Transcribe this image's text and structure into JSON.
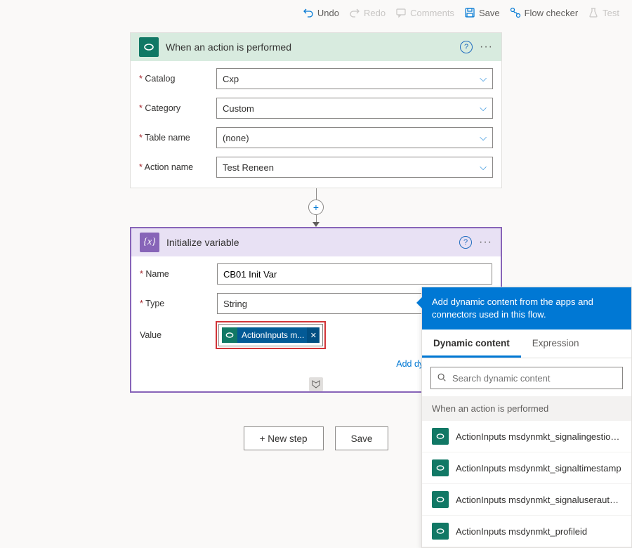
{
  "toolbar": {
    "undo": "Undo",
    "redo": "Redo",
    "comments": "Comments",
    "save": "Save",
    "flowchecker": "Flow checker",
    "test": "Test"
  },
  "trigger": {
    "title": "When an action is performed",
    "fields": {
      "catalog_label": "Catalog",
      "catalog_value": "Cxp",
      "category_label": "Category",
      "category_value": "Custom",
      "table_label": "Table name",
      "table_value": "(none)",
      "action_label": "Action name",
      "action_value": "Test Reneen"
    }
  },
  "initvar": {
    "title": "Initialize variable",
    "fields": {
      "name_label": "Name",
      "name_value": "CB01 Init Var",
      "type_label": "Type",
      "type_value": "String",
      "value_label": "Value",
      "token_text": "ActionInputs m..."
    },
    "dyn_link": "Add dynamic content"
  },
  "buttons": {
    "newstep": "+ New step",
    "save": "Save"
  },
  "dcp": {
    "header": "Add dynamic content from the apps and connectors used in this flow.",
    "tab_dynamic": "Dynamic content",
    "tab_expr": "Expression",
    "search_placeholder": "Search dynamic content",
    "section": "When an action is performed",
    "items": [
      "ActionInputs msdynmkt_signalingestiontimestamp",
      "ActionInputs msdynmkt_signaltimestamp",
      "ActionInputs msdynmkt_signaluserauthid",
      "ActionInputs msdynmkt_profileid"
    ]
  }
}
